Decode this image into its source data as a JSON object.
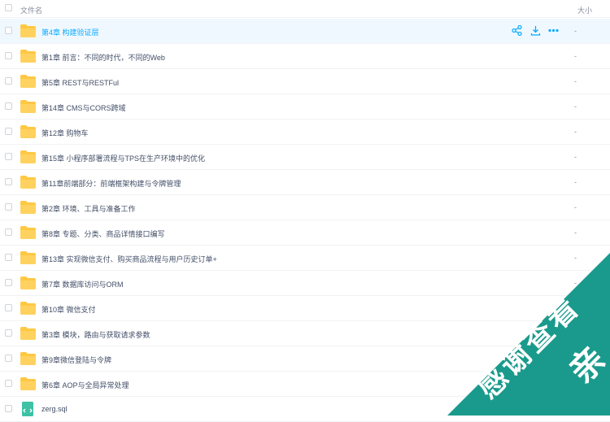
{
  "header": {
    "name_label": "文件名",
    "size_label": "大小"
  },
  "files": [
    {
      "name": "第4章 构建验证层",
      "size": "-",
      "type": "folder",
      "active": true
    },
    {
      "name": "第1章 前言：不同的时代，不同的Web",
      "size": "-",
      "type": "folder"
    },
    {
      "name": "第5章 REST与RESTFul",
      "size": "-",
      "type": "folder"
    },
    {
      "name": "第14章 CMS与CORS跨域",
      "size": "-",
      "type": "folder"
    },
    {
      "name": "第12章 购物车",
      "size": "-",
      "type": "folder"
    },
    {
      "name": "第15章 小程序部署流程与TPS在生产环境中的优化",
      "size": "-",
      "type": "folder"
    },
    {
      "name": "第11章前端部分：前端框架构建与令牌管理",
      "size": "-",
      "type": "folder"
    },
    {
      "name": "第2章 环境、工具与准备工作",
      "size": "-",
      "type": "folder"
    },
    {
      "name": "第8章 专题、分类、商品详情接口编写",
      "size": "-",
      "type": "folder"
    },
    {
      "name": "第13章 实现微信支付、购买商品流程与用户历史订单+",
      "size": "-",
      "type": "folder"
    },
    {
      "name": "第7章 数据库访问与ORM",
      "size": "-",
      "type": "folder"
    },
    {
      "name": "第10章 微信支付",
      "size": "-",
      "type": "folder"
    },
    {
      "name": "第3章 模块，路由与获取请求参数",
      "size": "-",
      "type": "folder"
    },
    {
      "name": "第9章微信登陆与令牌",
      "size": "-",
      "type": "folder"
    },
    {
      "name": "第6章 AOP与全局异常处理",
      "size": "-",
      "type": "folder"
    },
    {
      "name": "zerg.sql",
      "size": "",
      "type": "sql"
    }
  ],
  "row_actions": {
    "share_icon": "share-icon",
    "download_icon": "download-icon",
    "more_icon": "more-icon"
  },
  "ribbon": {
    "line1": "感谢查看",
    "line2": "亲",
    "color": "#1a9a8c"
  },
  "colors": {
    "accent": "#09aaff",
    "folder": "#ffc843",
    "active_bg": "#f0f8ff"
  }
}
